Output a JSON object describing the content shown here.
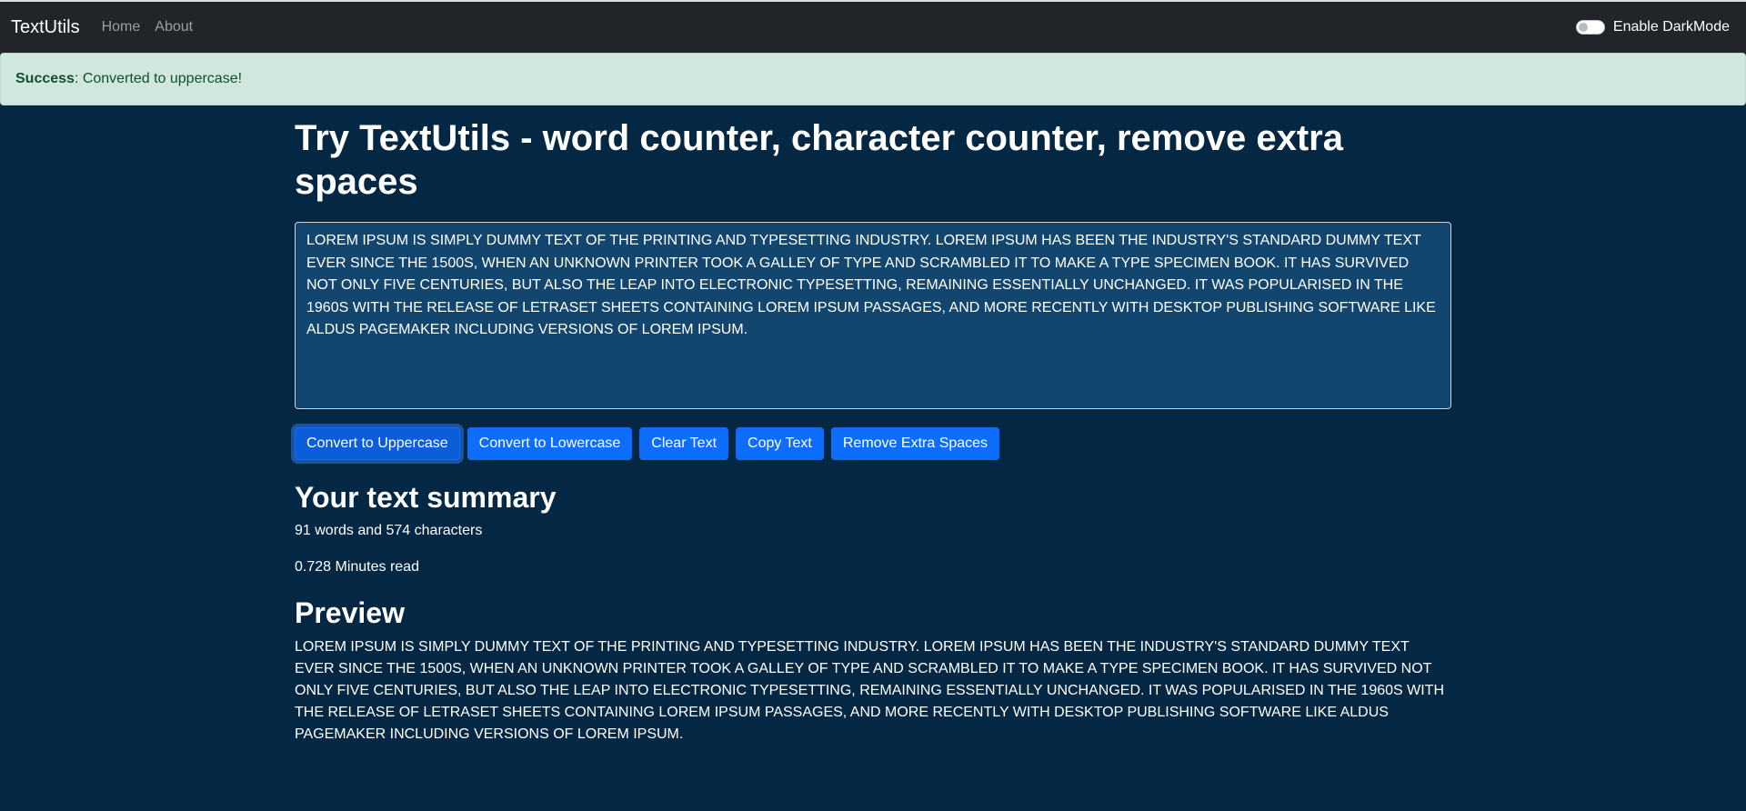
{
  "navbar": {
    "brand": "TextUtils",
    "links": [
      "Home",
      "About"
    ],
    "dark_mode_label": "Enable DarkMode"
  },
  "alert": {
    "type": "Success",
    "message": ": Converted to uppercase!"
  },
  "main": {
    "heading": "Try TextUtils - word counter, character counter, remove extra spaces",
    "textarea_value": "LOREM IPSUM IS SIMPLY DUMMY TEXT OF THE PRINTING AND TYPESETTING INDUSTRY. LOREM IPSUM HAS BEEN THE INDUSTRY'S STANDARD DUMMY TEXT EVER SINCE THE 1500S, WHEN AN UNKNOWN PRINTER TOOK A GALLEY OF TYPE AND SCRAMBLED IT TO MAKE A TYPE SPECIMEN BOOK. IT HAS SURVIVED NOT ONLY FIVE CENTURIES, BUT ALSO THE LEAP INTO ELECTRONIC TYPESETTING, REMAINING ESSENTIALLY UNCHANGED. IT WAS POPULARISED IN THE 1960S WITH THE RELEASE OF LETRASET SHEETS CONTAINING LOREM IPSUM PASSAGES, AND MORE RECENTLY WITH DESKTOP PUBLISHING SOFTWARE LIKE ALDUS PAGEMAKER INCLUDING VERSIONS OF LOREM IPSUM.",
    "buttons": [
      "Convert to Uppercase",
      "Convert to Lowercase",
      "Clear Text",
      "Copy Text",
      "Remove Extra Spaces"
    ]
  },
  "summary": {
    "heading": "Your text summary",
    "counts": "91 words and 574 characters",
    "read_time": "0.728 Minutes read"
  },
  "preview": {
    "heading": "Preview",
    "text": "LOREM IPSUM IS SIMPLY DUMMY TEXT OF THE PRINTING AND TYPESETTING INDUSTRY. LOREM IPSUM HAS BEEN THE INDUSTRY'S STANDARD DUMMY TEXT EVER SINCE THE 1500S, WHEN AN UNKNOWN PRINTER TOOK A GALLEY OF TYPE AND SCRAMBLED IT TO MAKE A TYPE SPECIMEN BOOK. IT HAS SURVIVED NOT ONLY FIVE CENTURIES, BUT ALSO THE LEAP INTO ELECTRONIC TYPESETTING, REMAINING ESSENTIALLY UNCHANGED. IT WAS POPULARISED IN THE 1960S WITH THE RELEASE OF LETRASET SHEETS CONTAINING LOREM IPSUM PASSAGES, AND MORE RECENTLY WITH DESKTOP PUBLISHING SOFTWARE LIKE ALDUS PAGEMAKER INCLUDING VERSIONS OF LOREM IPSUM."
  },
  "colors": {
    "page_bg": "#042743",
    "navbar_bg": "#212529",
    "textarea_bg": "#13466e",
    "button_primary": "#0d6efd",
    "alert_bg": "#d1e7dd",
    "alert_text": "#0f5132"
  },
  "dark_mode_toggle": {
    "on": false
  }
}
